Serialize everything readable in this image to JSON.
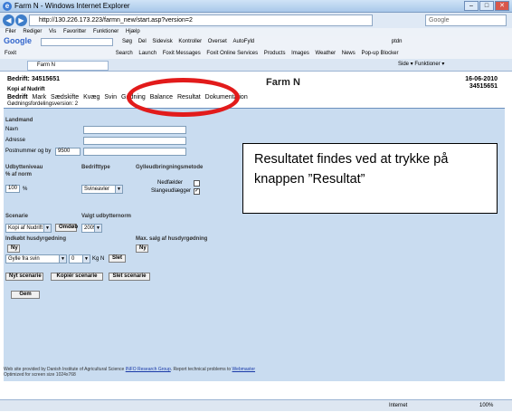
{
  "window": {
    "title": "Farm N - Windows Internet Explorer"
  },
  "address": {
    "url": "http://130.226.173.223/farmn_new/start.asp?version=2",
    "search_placeholder": "Google"
  },
  "menubar": {
    "items": [
      "Filer",
      "Rediger",
      "Vis",
      "Favoritter",
      "Funktioner",
      "Hjælp"
    ]
  },
  "toolbar1": {
    "google": "Google",
    "items": [
      "Søg",
      "Del",
      "Sidevisk",
      "Kontroller",
      "Overset",
      "AutoFyld",
      "ptdn"
    ]
  },
  "toolbar2": {
    "items": [
      "Foxit",
      "Search",
      "Launch",
      "Foxit Messages",
      "Foxit Online Services",
      "Products",
      "Images",
      "Weather",
      "News",
      "Pop-up Blocker"
    ]
  },
  "tab": {
    "label": "Farm N",
    "tools": "Side ▾  Funktioner ▾"
  },
  "page": {
    "bedrift": "Bedrift: 34515651",
    "kopi": "Kopi af Nudrift",
    "app_title": "Farm N",
    "date": "16-06-2010",
    "date_id": "34515651",
    "tabs": [
      "Bedrift",
      "Mark",
      "Sædskifte",
      "Kvæg",
      "Svin",
      "Gødning",
      "Balance",
      "Resultat",
      "Dokumentation"
    ],
    "version": "Gødningsfordelingsversion: 2"
  },
  "form": {
    "landmand": "Landmand",
    "navn": "Navn",
    "adresse": "Adresse",
    "postnummer": "Postnummer og by",
    "postnummer_value": "9500",
    "udbytteniveau": "Udbytteniveau",
    "pct_norm": "% af norm",
    "udbytte_value": "100",
    "pct": "%",
    "bedrifttype": "Bedrifttype",
    "bedrifttype_value": "Svineavler",
    "gylle": "Gylleudbringningsmetode",
    "nedfaelder": "Nedfælder",
    "slangeudlaegger": "Slangeudlægger",
    "scenarie": "Scenarie",
    "scenarie_value": "Kopi af Nudrift",
    "omdob": "Omdøb",
    "valgt": "Valgt udbytternorm",
    "valgt_value": "2009",
    "indkobt": "Indkøbt husdyrgødning",
    "ny1": "Ny",
    "max": "Max. salg af husdyrgødning",
    "ny2": "Ny",
    "gylle_value": "Gylle fra svin",
    "qty_value": "0",
    "kgn": "Kg N",
    "slet": "Slet",
    "nyt_scenarie": "Nyt scenarie",
    "kopier": "Kopiér scenarie",
    "slet_scenarie": "Slet scenarie",
    "gem": "Gem"
  },
  "callout": {
    "text": "Resultatet findes ved at trykke på knappen ”Resultat”"
  },
  "footer": {
    "line1_a": "Web site provided by Danish Institute of Agricultural Science ",
    "line1_link": "INFO Research Group",
    "line1_b": ". Report technical problems to ",
    "line1_link2": "Webmaster",
    "line2": "Optimized for screen size 1024x768"
  },
  "status": {
    "zone": "Internet",
    "zoom": "100%"
  }
}
